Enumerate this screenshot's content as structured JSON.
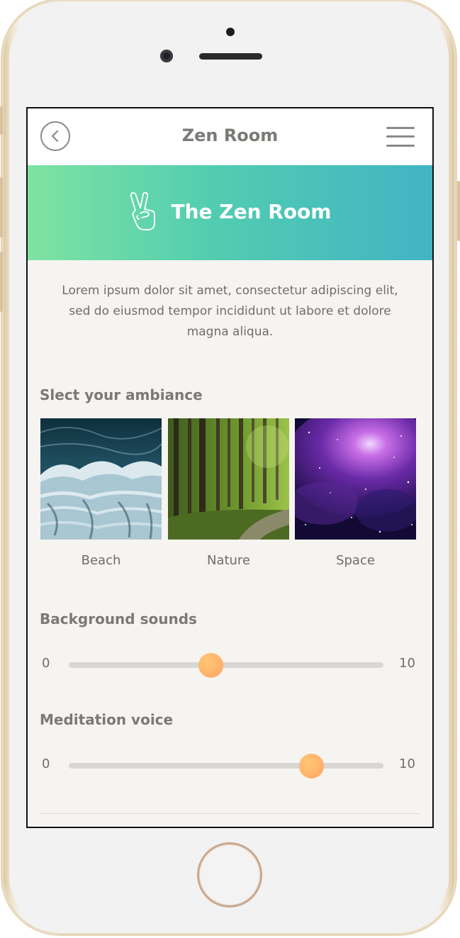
{
  "nav": {
    "title": "Zen Room"
  },
  "hero": {
    "title": "The Zen Room",
    "icon": "peace-hand-icon",
    "gradient": [
      "#7fe3a2",
      "#41b4c4"
    ]
  },
  "intro": {
    "text": "Lorem ipsum dolor sit amet, consectetur adipiscing elit, sed do eiusmod tempor incididunt ut labore et dolore magna aliqua."
  },
  "ambiance": {
    "title": "Slect your ambiance",
    "options": [
      {
        "label": "Beach"
      },
      {
        "label": "Nature"
      },
      {
        "label": "Space"
      }
    ]
  },
  "sliders": [
    {
      "title": "Background sounds",
      "min": "0",
      "max": "10",
      "value_fraction": 0.45
    },
    {
      "title": "Meditation voice",
      "min": "0",
      "max": "10",
      "value_fraction": 0.77
    }
  ],
  "colors": {
    "accent": "#ffb26b",
    "background": "#f6f4f0"
  }
}
